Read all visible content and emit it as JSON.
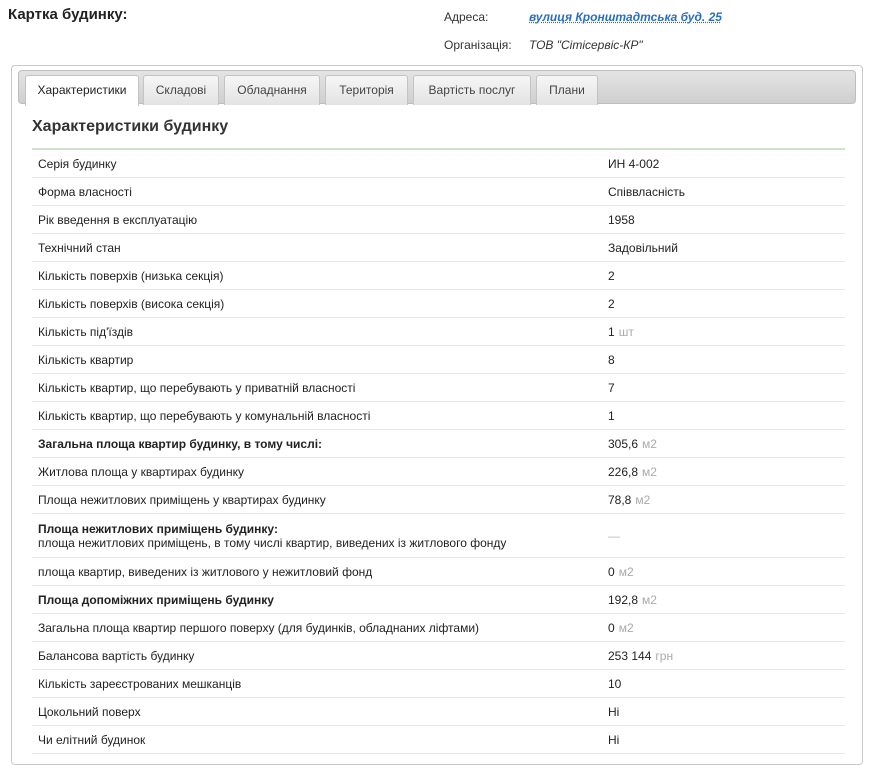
{
  "header": {
    "title": "Картка будинку:",
    "address_label": "Адреса:",
    "address_value": "вулиця Кронштадтська буд. 25",
    "org_label": "Організація:",
    "org_value": "ТОВ \"Сітісервіс-КР\""
  },
  "tabs": [
    {
      "label": "Характеристики"
    },
    {
      "label": "Складові"
    },
    {
      "label": "Обладнання"
    },
    {
      "label": "Територія"
    },
    {
      "label": "Вартість послуг"
    },
    {
      "label": "Плани"
    }
  ],
  "section": {
    "title": "Характеристики будинку"
  },
  "rows": [
    {
      "label": "Серія будинку",
      "value": "ИН 4-002",
      "unit": ""
    },
    {
      "label": "Форма власності",
      "value": "Співвласність",
      "unit": ""
    },
    {
      "label": "Рік введення в експлуатацію",
      "value": "1958",
      "unit": ""
    },
    {
      "label": "Технічний стан",
      "value": "Задовільний",
      "unit": ""
    },
    {
      "label": "Кількість поверхів (низька секція)",
      "value": "2",
      "unit": ""
    },
    {
      "label": "Кількість поверхів (висока секція)",
      "value": "2",
      "unit": ""
    },
    {
      "label": "Кількість під'їздів",
      "value": "1",
      "unit": "шт"
    },
    {
      "label": "Кількість квартир",
      "value": "8",
      "unit": ""
    },
    {
      "label": "Кількість квартир, що перебувають у приватній власності",
      "value": "7",
      "unit": ""
    },
    {
      "label": "Кількість квартир, що перебувають у комунальній власності",
      "value": "1",
      "unit": ""
    },
    {
      "label": "Загальна площа квартир будинку, в тому числі:",
      "value": "305,6",
      "unit": "м2"
    },
    {
      "label": "Житлова площа у квартирах будинку",
      "value": "226,8",
      "unit": "м2"
    },
    {
      "label": "Площа нежитлових приміщень у квартирах будинку",
      "value": "78,8",
      "unit": "м2"
    },
    {
      "label": "Площа нежитлових приміщень будинку:",
      "sublabel": "площа нежитлових приміщень, в тому числі квартир, виведених із житлового фонду",
      "value": "—",
      "unit": ""
    },
    {
      "label": "площа квартир, виведених із житлового у нежитловий фонд",
      "value": "0",
      "unit": "м2"
    },
    {
      "label": "Площа допоміжних приміщень будинку",
      "value": "192,8",
      "unit": "м2"
    },
    {
      "label": "Загальна площа квартир першого поверху (для будинків, обладнаних ліфтами)",
      "value": "0",
      "unit": "м2"
    },
    {
      "label": "Балансова вартість будинку",
      "value": "253 144",
      "unit": "грн"
    },
    {
      "label": "Кількість зареєстрованих мешканців",
      "value": "10",
      "unit": ""
    },
    {
      "label": "Цокольний поверх",
      "value": "Ні",
      "unit": ""
    },
    {
      "label": "Чи елітний будинок",
      "value": "Ні",
      "unit": ""
    }
  ]
}
